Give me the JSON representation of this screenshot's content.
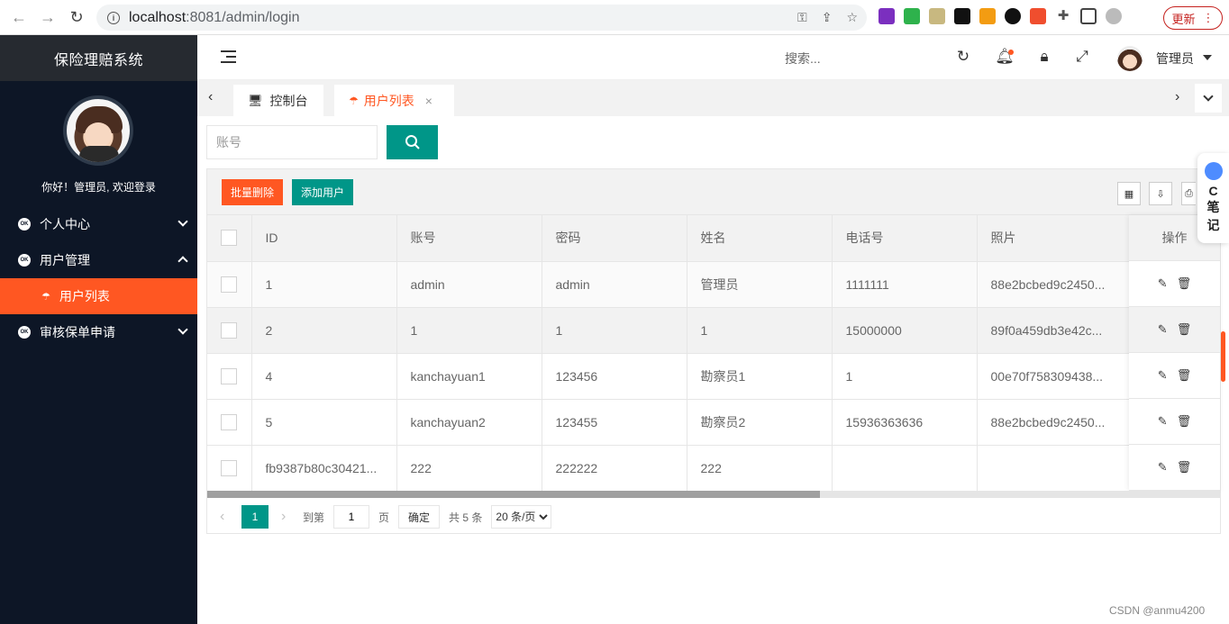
{
  "browser": {
    "url_host": "localhost",
    "url_rest": ":8081/admin/login",
    "update_label": "更新"
  },
  "sidebar": {
    "title": "保险理赔系统",
    "welcome": "你好！管理员, 欢迎登录",
    "items": [
      {
        "label": "个人中心"
      },
      {
        "label": "用户管理"
      },
      {
        "label": "用户列表"
      },
      {
        "label": "审核保单申请"
      }
    ]
  },
  "header": {
    "search_placeholder": "搜索...",
    "user_name": "管理员"
  },
  "tabs": [
    {
      "label": "控制台"
    },
    {
      "label": "用户列表"
    }
  ],
  "search": {
    "placeholder": "账号"
  },
  "toolbar": {
    "delete_label": "批量删除",
    "add_label": "添加用户"
  },
  "table": {
    "columns": [
      "ID",
      "账号",
      "密码",
      "姓名",
      "电话号",
      "照片"
    ],
    "op_header": "操作",
    "rows": [
      {
        "id": "1",
        "account": "admin",
        "password": "admin",
        "name": "管理员",
        "phone": "1111111",
        "photo": "88e2bcbed9c2450..."
      },
      {
        "id": "2",
        "account": "1",
        "password": "1",
        "name": "1",
        "phone": "15000000",
        "photo": "89f0a459db3e42c..."
      },
      {
        "id": "4",
        "account": "kanchayuan1",
        "password": "123456",
        "name": "勘察员1",
        "phone": "1",
        "photo": "00e70f758309438..."
      },
      {
        "id": "5",
        "account": "kanchayuan2",
        "password": "123455",
        "name": "勘察员2",
        "phone": "15936363636",
        "photo": "88e2bcbed9c2450..."
      },
      {
        "id": "fb9387b80c30421...",
        "account": "222",
        "password": "222222",
        "name": "222",
        "phone": "",
        "photo": ""
      }
    ]
  },
  "pager": {
    "current": "1",
    "goto_label": "到第",
    "goto_value": "1",
    "page_label": "页",
    "confirm_label": "确定",
    "total_label": "共 5 条",
    "page_size": "20 条/页"
  },
  "floating_note": {
    "c": "C",
    "label1": "笔",
    "label2": "记"
  },
  "watermark": "CSDN @anmu4200",
  "colors": {
    "sidebar_bg": "#0d1626",
    "accent_orange": "#ff5722",
    "accent_teal": "#009688"
  }
}
